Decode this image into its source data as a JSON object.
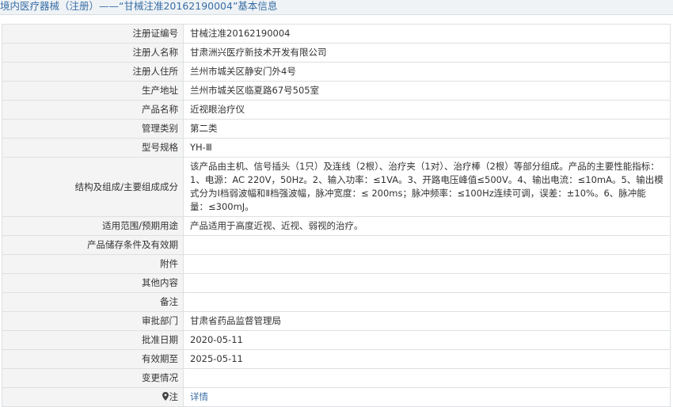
{
  "page_title": "境内医疗器械（注册）——“甘械注准20162190004”基本信息",
  "rows": [
    {
      "label": "注册证编号",
      "value": "甘械注准20162190004"
    },
    {
      "label": "注册人名称",
      "value": "甘肃洲兴医疗新技术开发有限公司"
    },
    {
      "label": "注册人住所",
      "value": "兰州市城关区静安门外4号"
    },
    {
      "label": "生产地址",
      "value": "兰州市城关区临夏路67号505室"
    },
    {
      "label": "产品名称",
      "value": "近视眼治疗仪"
    },
    {
      "label": "管理类别",
      "value": "第二类"
    },
    {
      "label": "型号规格",
      "value": "YH-Ⅲ"
    },
    {
      "label": "结构及组成/主要组成成分",
      "value": "该产品由主机、信号插头（1只）及连线（2根）、治疗夹（1对）、治疗棒（2根）等部分组成。产品的主要性能指标：1、电源：AC 220V，50Hz。2、输入功率：≤1VA。3、开路电压峰值≤500V。4、输出电流：≤10mA。5、输出模式分为Ⅰ档弱波幅和Ⅱ档强波幅，脉冲宽度：≤ 200ms；脉冲频率：≤100Hz连续可调，误差：±10%。6、脉冲能量：≤300mJ。"
    },
    {
      "label": "适用范围/预期用途",
      "value": "产品适用于高度近视、近视、弱视的治疗。"
    },
    {
      "label": "产品储存条件及有效期",
      "value": ""
    },
    {
      "label": "附件",
      "value": ""
    },
    {
      "label": "其他内容",
      "value": ""
    },
    {
      "label": "备注",
      "value": ""
    },
    {
      "label": "审批部门",
      "value": "甘肃省药品监督管理局"
    },
    {
      "label": "批准日期",
      "value": "2020-05-11"
    },
    {
      "label": "有效期至",
      "value": "2025-05-11"
    },
    {
      "label": "变更情况",
      "value": ""
    }
  ],
  "footer_row": {
    "label": "注",
    "icon": "map-pin-icon",
    "link_text": "详情"
  }
}
